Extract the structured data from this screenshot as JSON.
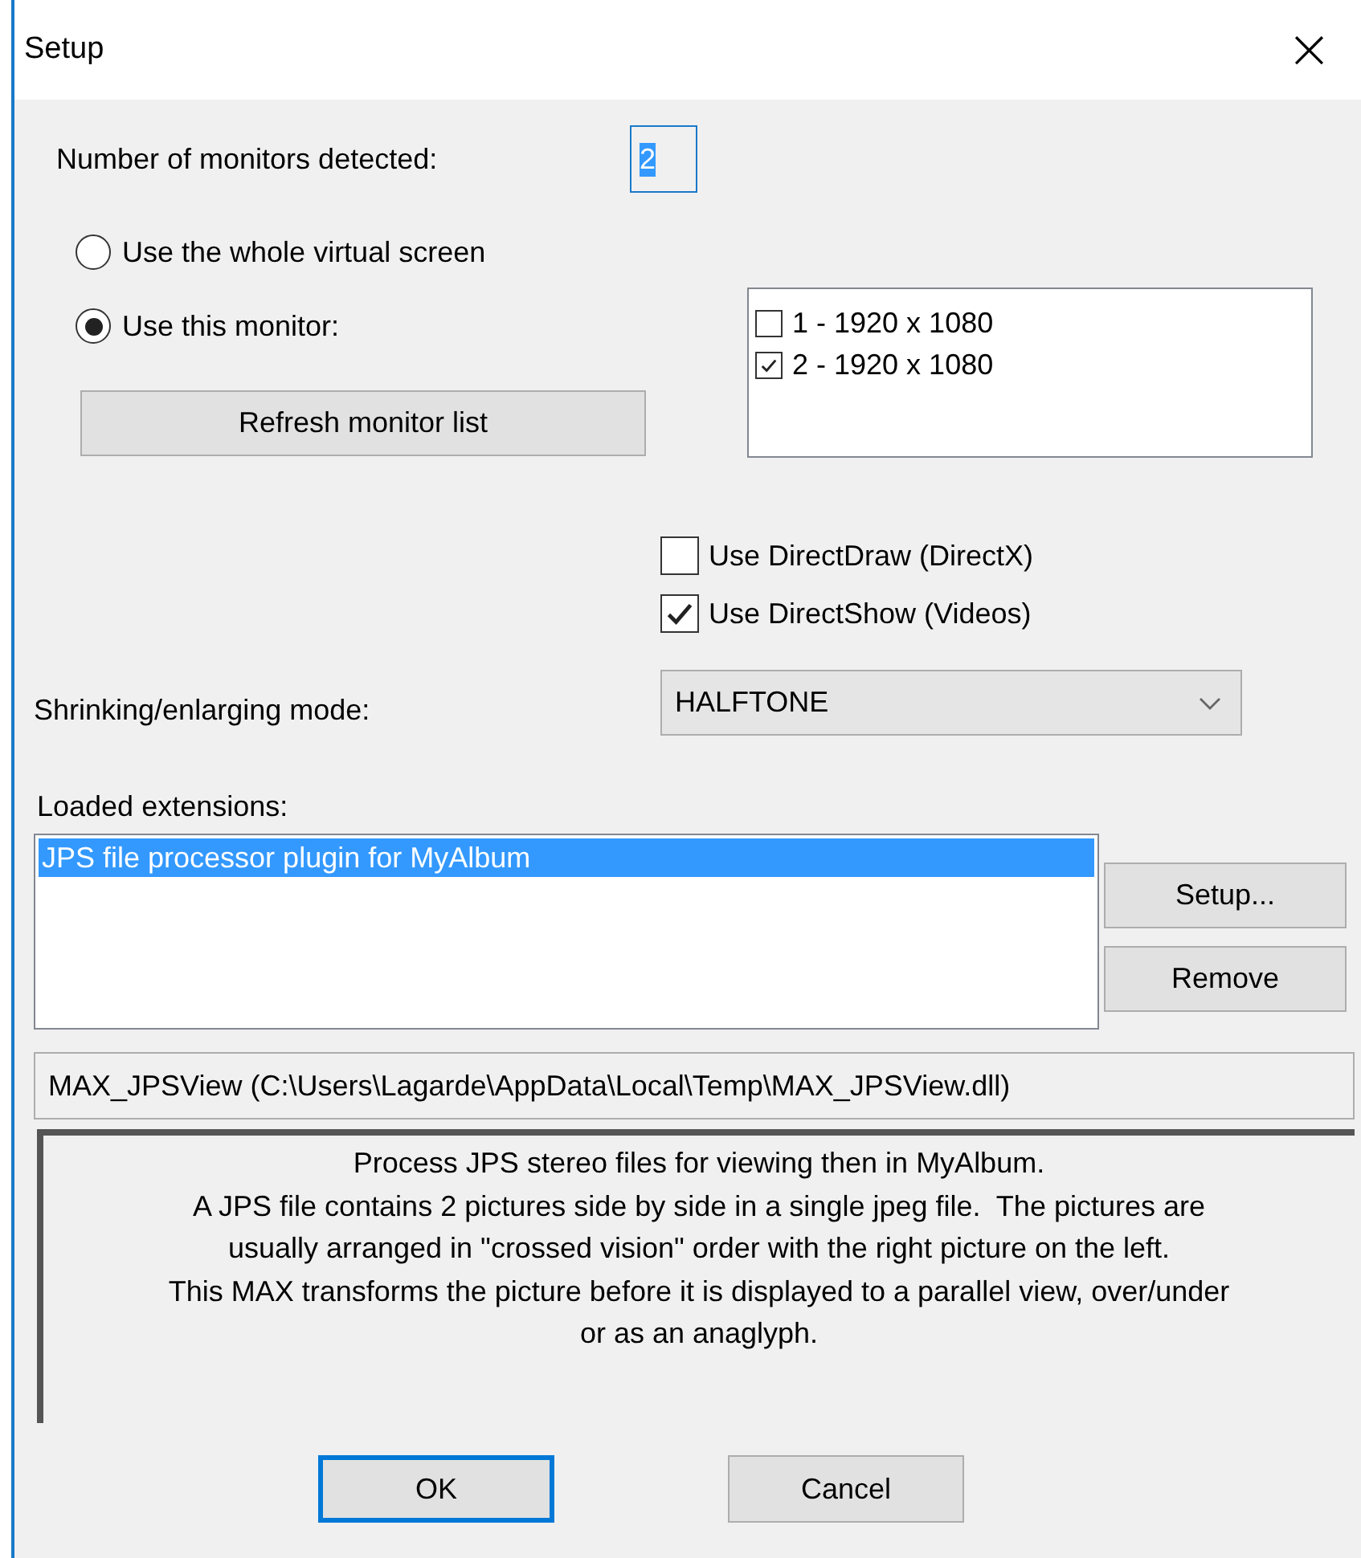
{
  "window": {
    "title": "Setup",
    "close": "×"
  },
  "monitors_detected": {
    "label": "Number of monitors detected:",
    "value": "2"
  },
  "screen_mode": [
    {
      "label": "Use the whole virtual screen",
      "selected": false
    },
    {
      "label": "Use this monitor:",
      "selected": true
    }
  ],
  "refresh_button": "Refresh monitor list",
  "monitor_list": [
    {
      "label": "1 - 1920 x 1080",
      "checked": false
    },
    {
      "label": "2 - 1920 x 1080",
      "checked": true
    }
  ],
  "options": [
    {
      "label": "Use DirectDraw (DirectX)",
      "checked": false
    },
    {
      "label": "Use DirectShow (Videos)",
      "checked": true
    }
  ],
  "scaling": {
    "label": "Shrinking/enlarging mode:",
    "value": "HALFTONE"
  },
  "extensions": {
    "label": "Loaded extensions:",
    "items": [
      {
        "label": "JPS file processor plugin for MyAlbum",
        "selected": true
      }
    ],
    "buttons": [
      "Setup...",
      "Remove"
    ]
  },
  "path": "MAX_JPSView (C:\\Users\\Lagarde\\AppData\\Local\\Temp\\MAX_JPSView.dll)",
  "description": [
    "Process JPS stereo files for viewing then in MyAlbum.",
    "A JPS file contains 2 pictures side by side in a single jpeg file.  The pictures are",
    "usually arranged in \"crossed vision\" order with the right picture on the left.",
    "This MAX transforms the picture before it is displayed to a parallel view, over/under",
    "or as an anaglyph."
  ],
  "buttons": [
    {
      "label": "OK",
      "kind": "default"
    },
    {
      "label": "Cancel",
      "kind": "normal"
    }
  ]
}
